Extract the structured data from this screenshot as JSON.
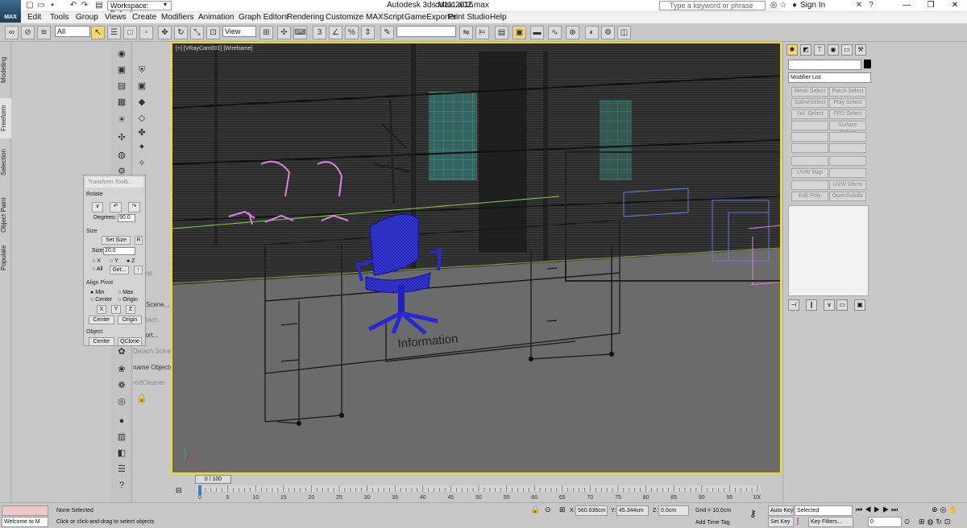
{
  "window": {
    "app_title": "Autodesk 3ds Max 2016",
    "file_name": "co111 a02.max",
    "logo_text": "MAX",
    "workspace": "Workspace: Default",
    "search_placeholder": "Type a keyword or phrase",
    "signin": "Sign In"
  },
  "menu": [
    "Edit",
    "Tools",
    "Group",
    "Views",
    "Create",
    "Modifiers",
    "Animation",
    "Graph Editors",
    "Rendering",
    "Customize",
    "MAXScript",
    "GameExporter",
    "Print Studio",
    "Help"
  ],
  "toolbar": {
    "selection_filter": "All",
    "ref_coord": "View",
    "named_selection": ""
  },
  "left_tabs": [
    "Modeling",
    "Freeform",
    "Selection",
    "Object Paint",
    "Populate"
  ],
  "left_menu_labels": [
    "ft Loop",
    "Scene...",
    "tach",
    "port...",
    "Detach Solve",
    "name Objects",
    "rodCleaner"
  ],
  "transform_toolbox": {
    "title": "Transform Toolb...",
    "rotate_label": "Rotate",
    "degrees_label": "Degrees:",
    "degrees_value": "90.0",
    "size_label": "Size",
    "set_size": "Set Size",
    "r_button": "R",
    "size_field_label": "Size",
    "size_value": "20.0",
    "axis_x": "X",
    "axis_y": "Y",
    "axis_z": "Z",
    "all": "All",
    "get": "Get...",
    "align_pivot": "Align Pivot",
    "min": "Min",
    "max": "Max",
    "center": "Center",
    "origin": "Origin",
    "btn_x": "X",
    "btn_y": "Y",
    "btn_z": "Z",
    "center_btn": "Center",
    "origin_btn": "Origin",
    "object": "Object",
    "object_center": "Center",
    "qclone": "QClone"
  },
  "viewport": {
    "label": "[+] [VRayCam001] [Wireframe]",
    "text_on_desk": "Information",
    "border_color": "#f2dc1c"
  },
  "command_panel": {
    "modifier_list": "Modifier List",
    "buttons": [
      "Mesh Select",
      "Patch Select",
      "SplineSelect",
      "Poly Select",
      "Vol. Select",
      "FFD Select",
      "",
      "Surface Select",
      "",
      "",
      "",
      "",
      "",
      "",
      "UVW Map",
      "",
      "",
      "UVW Xform",
      "Edit Poly",
      "OpenSubdiv"
    ]
  },
  "timeline": {
    "slider": "0 / 100",
    "ticks": [
      "0",
      "5",
      "10",
      "15",
      "20",
      "25",
      "30",
      "35",
      "40",
      "45",
      "50",
      "55",
      "60",
      "65",
      "70",
      "75",
      "80",
      "85",
      "90",
      "95",
      "100"
    ]
  },
  "status": {
    "maxscript": "Welcome to M",
    "selection": "None Selected",
    "prompt": "Click or click-and-drag to select objects",
    "x_label": "X:",
    "x_value": "560.636cm",
    "y_label": "Y:",
    "y_value": "45.344cm",
    "z_label": "Z:",
    "z_value": "0.0cm",
    "grid": "Grid = 10.0cm",
    "add_time_tag": "Add Time Tag",
    "auto_key": "Auto Key",
    "set_key": "Set Key",
    "key_mode": "Selected",
    "key_filters": "Key Filters...",
    "frame": "0"
  }
}
